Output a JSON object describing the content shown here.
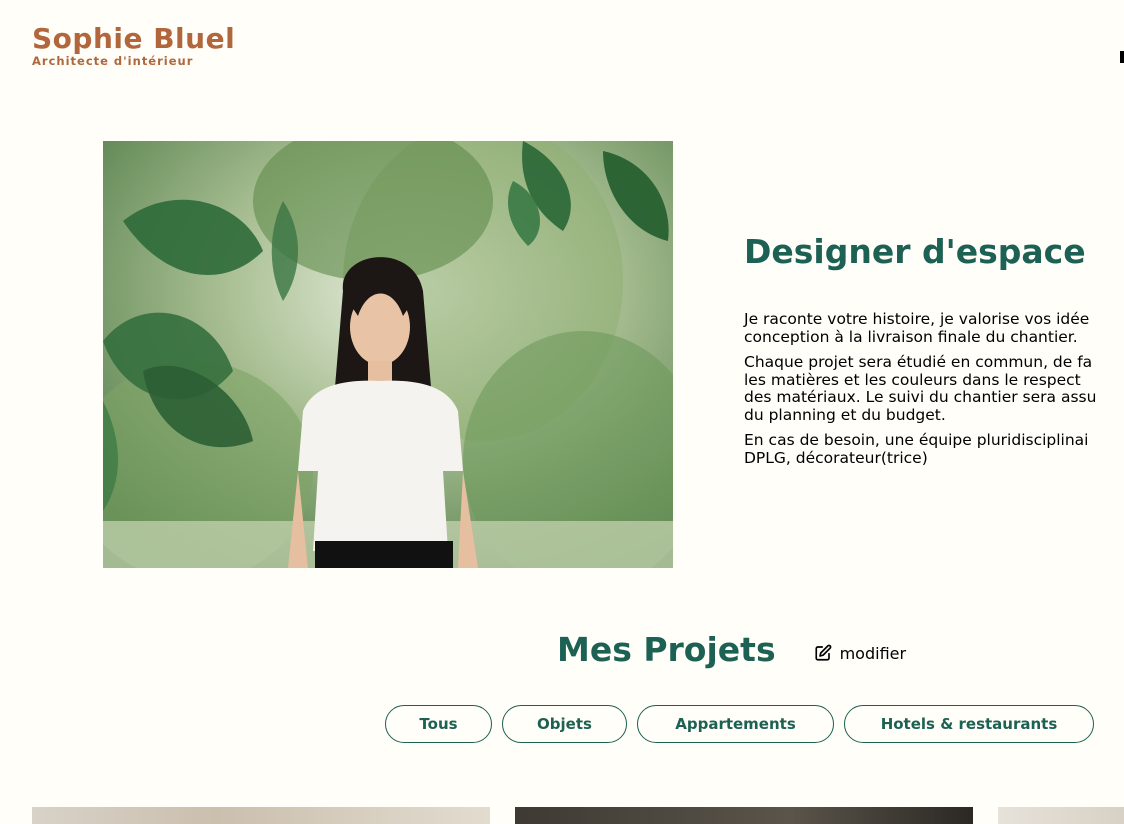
{
  "header": {
    "logo_name": "Sophie Bluel",
    "logo_subtitle": "Architecte d'intérieur"
  },
  "intro": {
    "title": "Designer d'espace",
    "paragraphs": [
      "Je raconte votre histoire, je valorise vos idée\nconception à la livraison finale du chantier.",
      "Chaque projet sera étudié en commun, de fa\nles matières et les couleurs dans le respect\ndes matériaux. Le suivi du chantier sera assu\ndu planning et du budget.",
      "En cas de besoin, une équipe pluridisciplinai\nDPLG, décorateur(trice)"
    ]
  },
  "projects": {
    "title": "Mes Projets",
    "edit_label": "modifier",
    "filters": [
      "Tous",
      "Objets",
      "Appartements",
      "Hotels & restaurants"
    ]
  },
  "colors": {
    "accent": "#1D6154",
    "brand": "#B1663C",
    "background": "#FFFEF8"
  },
  "icons": {
    "edit": "pen-to-square-icon"
  }
}
